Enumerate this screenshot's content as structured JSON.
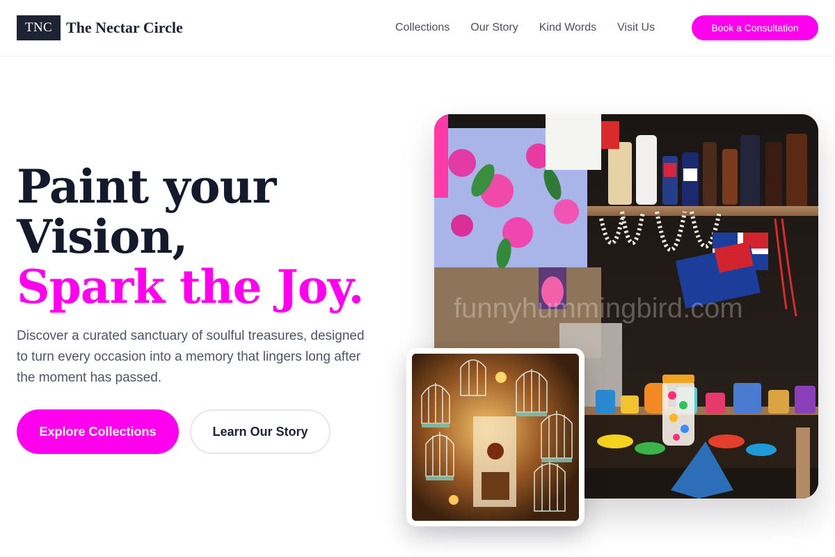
{
  "brand": {
    "mark": "TNC",
    "name": "The Nectar Circle"
  },
  "nav": {
    "items": [
      "Collections",
      "Our Story",
      "Kind Words",
      "Visit Us"
    ],
    "cta": "Book a Consultation"
  },
  "hero": {
    "title_line1": "Paint your",
    "title_line2": "Vision,",
    "title_accent": "Spark the Joy.",
    "subtitle": "Discover a curated sanctuary of soulful treasures, designed to turn every occasion into a memory that lingers long after the moment has passed.",
    "primary_button": "Explore Collections",
    "secondary_button": "Learn Our Story"
  },
  "images": {
    "main_watermark": "funnyhummingbird.com"
  },
  "colors": {
    "accent": "#ff00ee",
    "ink": "#1d2333",
    "muted": "#4e5566"
  }
}
